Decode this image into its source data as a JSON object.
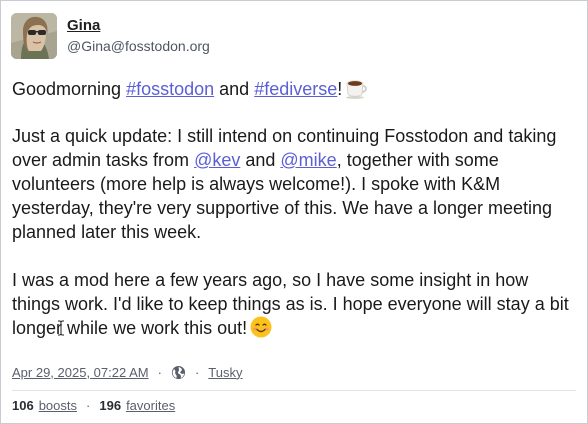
{
  "author": {
    "display_name": "Gina",
    "handle": "@Gina@fosstodon.org",
    "avatar_icon": "user-avatar-photo"
  },
  "post": {
    "line1": {
      "text_a": "Goodmorning ",
      "tag1": "#fosstodon",
      "text_b": " and ",
      "tag2": "#fediverse",
      "text_c": "!",
      "emoji": "coffee-emoji"
    },
    "para2": {
      "text_a": "Just a quick update: I still intend on continuing Fosstodon and taking over admin tasks from ",
      "mention1": "@kev",
      "text_b": " and ",
      "mention2": "@mike",
      "text_c": ", together with some volunteers (more help is always welcome!). I spoke with K&M yesterday, they're very supportive of this. We have a longer meeting planned later this week."
    },
    "para3": {
      "text_a": "I was a mod here a few years ago, so I have some insight in how things work. I'd like to keep things as is. I hope everyone will stay a bit longer",
      "text_b": " while we work this out!",
      "emoji": "smiling-face-emoji"
    }
  },
  "meta": {
    "timestamp": "Apr 29, 2025, 07:22 AM",
    "separator": "·",
    "visibility_icon": "globe-icon",
    "client": "Tusky"
  },
  "stats": {
    "boosts_count": "106",
    "boosts_label": "boosts",
    "separator": "·",
    "favorites_count": "196",
    "favorites_label": "favorites"
  },
  "colors": {
    "link": "#5b5fd6",
    "muted": "#5a5f6b",
    "border": "#c9ccd3"
  }
}
